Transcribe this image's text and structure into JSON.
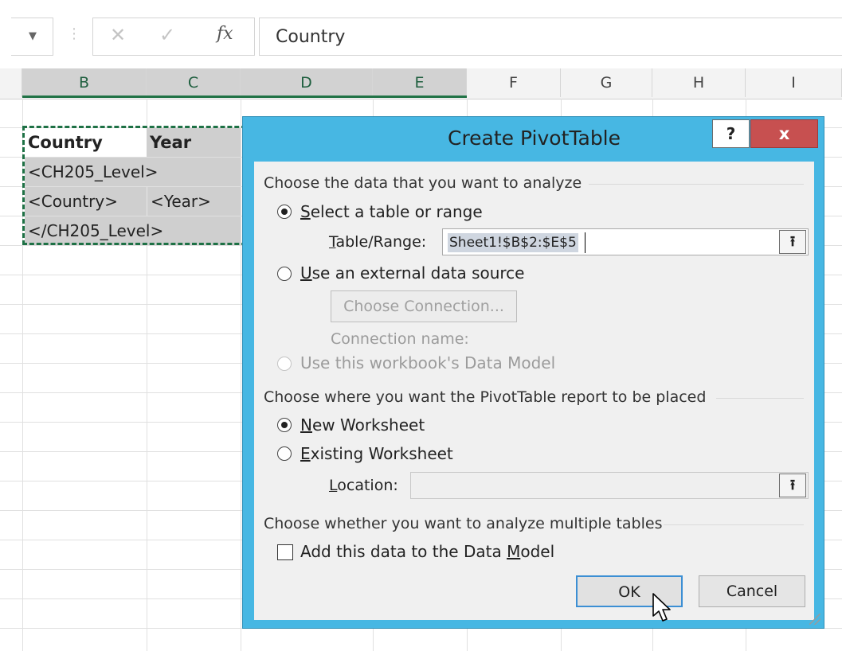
{
  "formula_bar": {
    "cancel_icon": "x-icon",
    "enter_icon": "checkmark-icon",
    "fx_label": "fx",
    "value": "Country"
  },
  "columns": [
    "B",
    "C",
    "D",
    "E",
    "F",
    "G",
    "H",
    "I"
  ],
  "cells": {
    "b3": "Country",
    "c3": "Year",
    "b4": "<CH205_Level>",
    "b5": "<Country>",
    "c5": "<Year>",
    "b6": "</CH205_Level>"
  },
  "dialog": {
    "title": "Create PivotTable",
    "help_label": "?",
    "close_label": "x",
    "section_data": "Choose the data that you want to analyze",
    "opt_select_range_prefix": "",
    "opt_select_range_u": "S",
    "opt_select_range_rest": "elect a table or range",
    "table_range_u": "T",
    "table_range_rest": "able/Range:",
    "table_range_value": "Sheet1!$B$2:$E$5",
    "opt_external_u": "U",
    "opt_external_rest": "se an external data source",
    "choose_connection_label": "Choose Connection...",
    "connection_name_label": "Connection name:",
    "opt_data_model": "Use this workbook's Data Model",
    "section_place": "Choose where you want the PivotTable report to be placed",
    "opt_new_ws_u": "N",
    "opt_new_ws_rest": "ew Worksheet",
    "opt_existing_ws_u": "E",
    "opt_existing_ws_rest": "xisting Worksheet",
    "location_u": "L",
    "location_rest": "ocation:",
    "location_value": "",
    "section_multi": "Choose whether you want to analyze multiple tables",
    "add_to_model_prefix": "Add this data to the Data ",
    "add_to_model_u": "M",
    "add_to_model_rest": "odel",
    "ok_label": "OK",
    "cancel_label": "Cancel",
    "collapse_icon": "collapse-dialog-icon"
  },
  "colors": {
    "dialog_frame": "#47b7e3",
    "close_button": "#c75050",
    "selection_border": "#1e7145"
  }
}
